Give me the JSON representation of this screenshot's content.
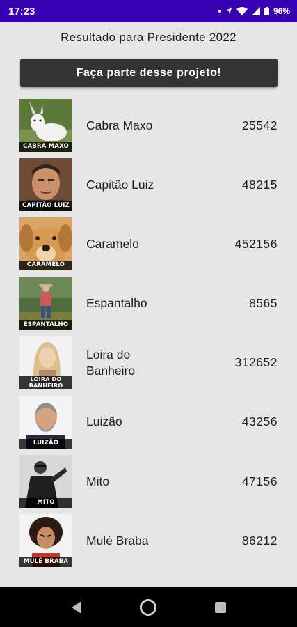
{
  "status": {
    "time": "17:23",
    "battery": "96%"
  },
  "page": {
    "title": "Resultado para Presidente 2022",
    "join_button": "Faça parte desse projeto!"
  },
  "candidates": [
    {
      "name": "Cabra Maxo",
      "caption": "CABRA MAXO",
      "votes": "25542",
      "image": "goat"
    },
    {
      "name": "Capitão Luiz",
      "caption": "CAPITÃO LUIZ",
      "votes": "48215",
      "image": "man-portrait"
    },
    {
      "name": "Caramelo",
      "caption": "CARAMELO",
      "votes": "452156",
      "image": "dog"
    },
    {
      "name": "Espantalho",
      "caption": "ESPANTALHO",
      "votes": "8565",
      "image": "scarecrow-field"
    },
    {
      "name": "Loira do Banheiro",
      "caption": "LOIRA DO BANHEIRO",
      "votes": "312652",
      "image": "blonde-woman"
    },
    {
      "name": "Luizão",
      "caption": "LUIZÃO",
      "votes": "43256",
      "image": "smiling-man"
    },
    {
      "name": "Mito",
      "caption": "MITO",
      "votes": "47156",
      "image": "man-sunglasses"
    },
    {
      "name": "Mulé Braba",
      "caption": "MULÉ BRABA",
      "votes": "86212",
      "image": "angry-woman"
    }
  ]
}
